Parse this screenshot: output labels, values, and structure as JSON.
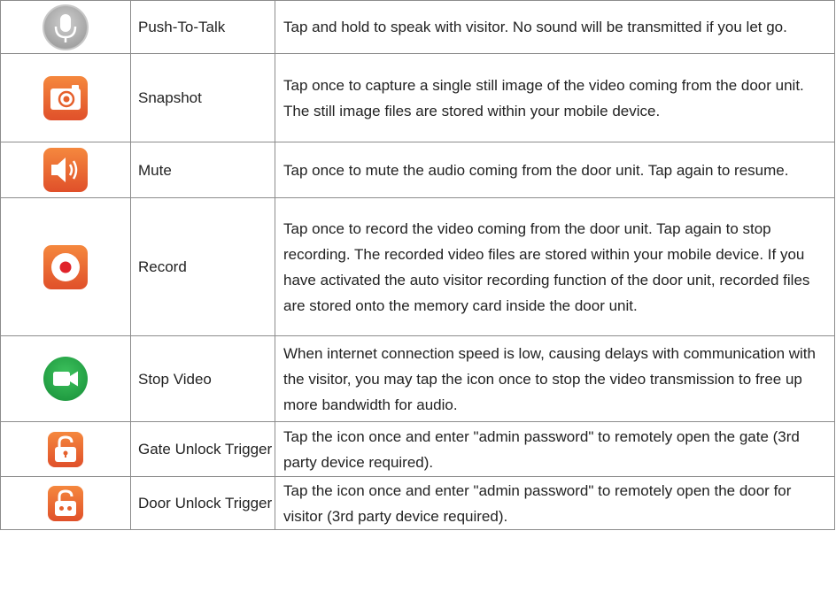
{
  "colors": {
    "border": "#8c8c8c",
    "text": "#222222",
    "orange": "#e5602c",
    "orange_light": "#f5883e",
    "green": "#27a64a",
    "gray": "#b3b3b3"
  },
  "rows": [
    {
      "icon": "microphone-icon",
      "name": "Push-To-Talk",
      "description": "Tap and hold to speak with visitor.  No sound will be transmitted if you let go."
    },
    {
      "icon": "camera-icon",
      "name": "Snapshot",
      "description": "Tap once to capture a single still image of the video coming from the door unit.  The still image files are stored within your mobile device."
    },
    {
      "icon": "speaker-icon",
      "name": "Mute",
      "description": "Tap once to mute the audio coming from the door unit.  Tap again to resume."
    },
    {
      "icon": "record-icon",
      "name": "Record",
      "description": "Tap once to record the video coming from the door unit.  Tap again to stop recording.  The recorded video files are stored within your mobile device.  If you have activated the auto visitor recording function of the door unit, recorded files are stored onto the memory card inside the door unit."
    },
    {
      "icon": "video-camera-icon",
      "name": "Stop Video",
      "description": "When internet connection speed is low, causing delays with communication with the visitor, you may tap the icon once to stop the video transmission to free up more bandwidth for audio."
    },
    {
      "icon": "gate-unlock-icon",
      "name": "Gate Unlock Trigger",
      "description": "Tap the icon once and enter \"admin password\" to remotely open the gate (3rd party device required)."
    },
    {
      "icon": "door-unlock-icon",
      "name": "Door Unlock Trigger",
      "description": "Tap the icon once and enter \"admin password\" to remotely open the door for visitor (3rd party device required)."
    }
  ]
}
